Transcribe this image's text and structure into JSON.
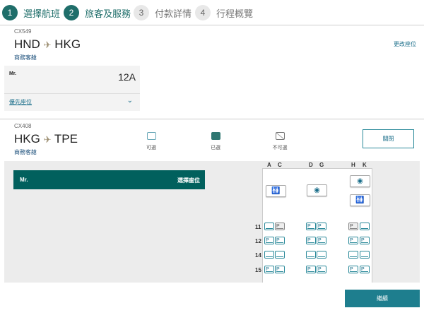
{
  "steps": [
    {
      "n": "1",
      "label": "選擇航班"
    },
    {
      "n": "2",
      "label": "旅客及服務"
    },
    {
      "n": "3",
      "label": "付款詳情"
    },
    {
      "n": "4",
      "label": "行程概覽"
    }
  ],
  "flight1": {
    "number": "CX549",
    "from": "HND",
    "to": "HKG",
    "cabin": "商務客艙",
    "change_seat": "更改座位",
    "passenger": "Mr.",
    "seat": "12A",
    "priority": "優先座位"
  },
  "flight2": {
    "number": "CX408",
    "from": "HKG",
    "to": "TPE",
    "cabin": "商務客艙",
    "close": "關閉",
    "passenger": "Mr.",
    "select_seat": "選擇座位"
  },
  "legend": {
    "available": "可選",
    "selected": "已選",
    "unavailable": "不可選"
  },
  "seatmap": {
    "columns": [
      "A",
      "C",
      "D",
      "G",
      "H",
      "K"
    ],
    "rows": [
      {
        "row": "11",
        "seats": [
          "avail",
          "na",
          "P",
          "P",
          "na",
          "avail"
        ]
      },
      {
        "row": "12",
        "seats": [
          "P",
          "P",
          "P",
          "P",
          "P",
          "P"
        ]
      },
      {
        "row": "14",
        "seats": [
          "avail",
          "avail",
          "avail",
          "avail",
          "avail",
          "avail"
        ]
      },
      {
        "row": "15",
        "seats": [
          "P",
          "P",
          "P",
          "P",
          "P",
          "P"
        ]
      }
    ]
  },
  "continue": "繼續",
  "colors": {
    "accent": "#01605d",
    "link": "#1a6e8a"
  }
}
